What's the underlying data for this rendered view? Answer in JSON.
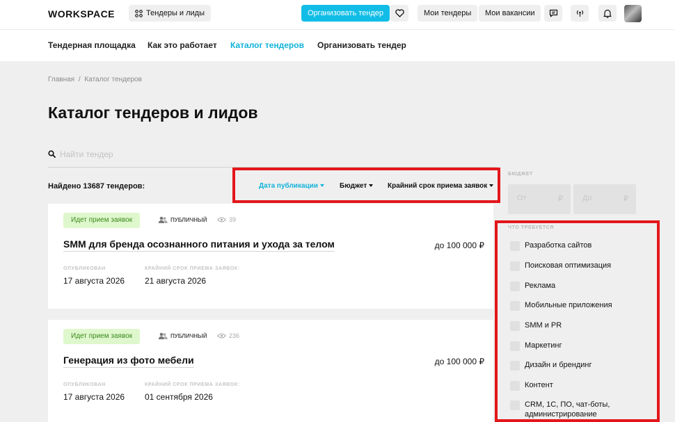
{
  "topbar": {
    "logo": "WORKSPACE",
    "tenders_leads": "Тендеры и лиды",
    "organize_btn": "Организовать тендер",
    "my_tenders": "Мои тендеры",
    "my_vacancies": "Мои вакансии"
  },
  "subnav": [
    "Тендерная площадка",
    "Как это работает",
    "Каталог тендеров",
    "Организовать тендер"
  ],
  "breadcrumb": {
    "home": "Главная",
    "sep": "/",
    "current": "Каталог тендеров"
  },
  "page_title": "Каталог тендеров и лидов",
  "search": {
    "placeholder": "Найти тендер",
    "value": ""
  },
  "found": "Найдено 13687 тендеров:",
  "sorts": [
    "Дата публикации",
    "Бюджет",
    "Крайний срок приема заявок"
  ],
  "tenders": [
    {
      "status": "Идет прием заявок",
      "visibility": "ПУБЛИЧНЫЙ",
      "views": "39",
      "title": "SMM для бренда осознанного питания и ухода за телом",
      "price": "до 100 000 ₽",
      "published_label": "ОПУБЛИКОВАН",
      "published": "17 августа 2026",
      "deadline_label": "КРАЙНИЙ СРОК ПРИЕМА ЗАЯВОК:",
      "deadline": "21 августа 2026"
    },
    {
      "status": "Идет прием заявок",
      "visibility": "ПУБЛИЧНЫЙ",
      "views": "236",
      "title": "Генерация из фото мебели",
      "price": "до 100 000 ₽",
      "published_label": "ОПУБЛИКОВАН",
      "published": "17 августа 2026",
      "deadline_label": "КРАЙНИЙ СРОК ПРИЕМА ЗАЯВОК:",
      "deadline": "01 сентября 2026"
    }
  ],
  "filters": {
    "budget_label": "БЮДЖЕТ",
    "from": "От",
    "to": "До",
    "currency": "₽",
    "requirements_label": "ЧТО ТРЕБУЕТСЯ",
    "requirements": [
      "Разработка сайтов",
      "Поисковая оптимизация",
      "Реклама",
      "Мобильные приложения",
      "SMM и PR",
      "Маркетинг",
      "Дизайн и брендинг",
      "Контент",
      "CRM, 1С, ПО, чат-боты, администрирование"
    ]
  },
  "colors": {
    "accent": "#11bde6",
    "highlight": "#e3161b",
    "status_bg": "#dff7cc",
    "status_text": "#3a8a1d"
  }
}
